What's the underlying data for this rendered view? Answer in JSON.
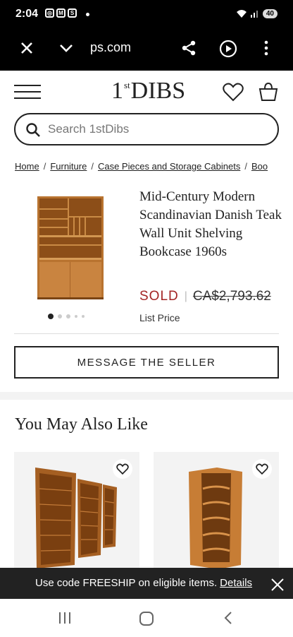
{
  "status_bar": {
    "time": "2:04",
    "battery": "40"
  },
  "browser": {
    "url": "ps.com"
  },
  "header": {
    "logo_main": "DIBS",
    "logo_one": "1",
    "logo_st": "st"
  },
  "search": {
    "placeholder": "Search 1stDibs"
  },
  "breadcrumb": {
    "items": [
      "Home",
      "Furniture",
      "Case Pieces and Storage Cabinets",
      "Boo"
    ]
  },
  "product": {
    "title": "Mid-Century Modern Scandinavian Danish Teak Wall Unit Shelving Bookcase 1960s",
    "status": "SOLD",
    "price": "CA$2,793.62",
    "price_note": "List Price",
    "image_count": 5,
    "active_image": 1
  },
  "actions": {
    "message_seller": "MESSAGE THE SELLER"
  },
  "recommendations": {
    "title": "You May Also Like"
  },
  "promo": {
    "text": "Use code FREESHIP on eligible items.",
    "link": "Details"
  }
}
